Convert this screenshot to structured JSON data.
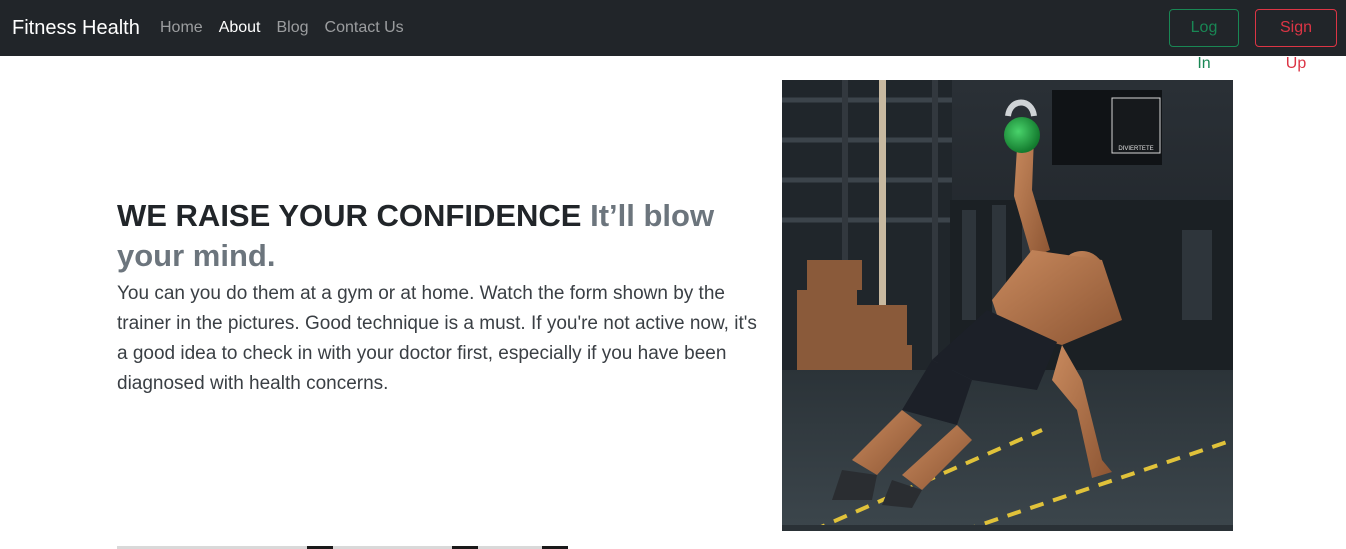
{
  "nav": {
    "brand": "Fitness Health",
    "links": [
      {
        "label": "Home",
        "active": false
      },
      {
        "label": "About",
        "active": true
      },
      {
        "label": "Blog",
        "active": false
      },
      {
        "label": "Contact Us",
        "active": false
      }
    ],
    "login_label": "Log In",
    "signup_label": "Sign Up"
  },
  "hero": {
    "headline_main": "WE RAISE YOUR CONFIDENCE",
    "headline_muted": "It’ll blow your mind.",
    "body": "You can you do them at a gym or at home. Watch the form shown by the trainer in the pictures. Good technique is a must. If you're not active now, it's a good idea to check in with your doctor first, especially if you have been diagnosed with health concerns.",
    "image": {
      "alt": "Athlete performing a kettlebell exercise in a gym",
      "sign_text": "DIVIERTETE"
    }
  },
  "colors": {
    "navbar_bg": "#212529",
    "success": "#198754",
    "danger": "#dc3545",
    "heading": "#212529",
    "muted": "#6c757d"
  }
}
